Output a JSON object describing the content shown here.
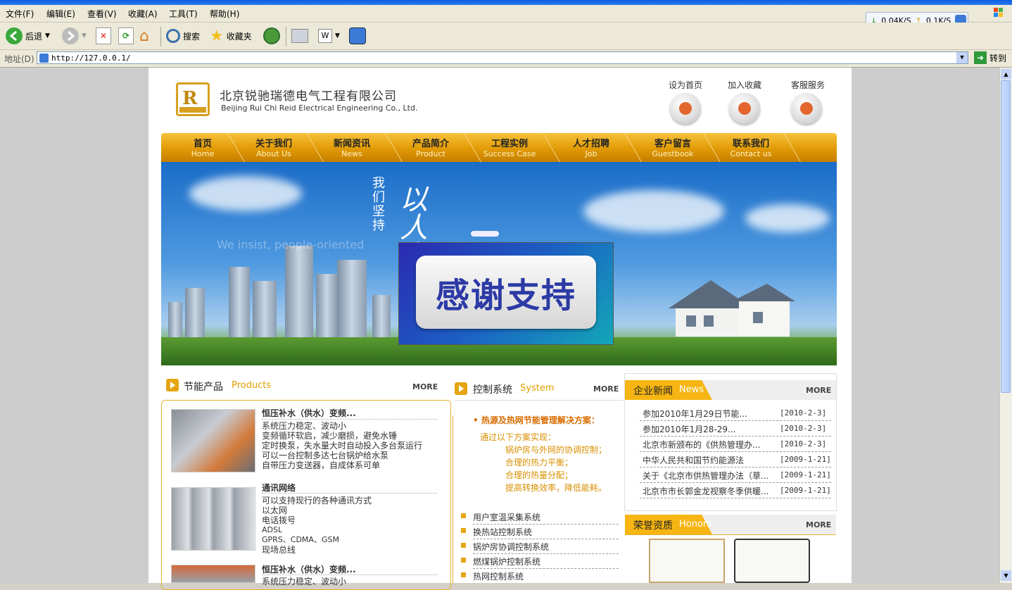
{
  "browser": {
    "menu": [
      "文件(F)",
      "编辑(E)",
      "查看(V)",
      "收藏(A)",
      "工具(T)",
      "帮助(H)"
    ],
    "toolbar": {
      "back": "后退",
      "search": "搜索",
      "favorites": "收藏夹"
    },
    "address_label": "地址(D)",
    "address_value": "http://127.0.0.1/",
    "go_label": "转到",
    "speed_down": "0.04K/S",
    "speed_up": "0.1K/S"
  },
  "header": {
    "company_cn": "北京锐驰瑞德电气工程有限公司",
    "company_en": "Beijing Rui Chi Reid Electrical Engineering Co., Ltd.",
    "links": [
      "设为首页",
      "加入收藏",
      "客服服务"
    ]
  },
  "nav": [
    {
      "cn": "首页",
      "en": "Home"
    },
    {
      "cn": "关于我们",
      "en": "About Us"
    },
    {
      "cn": "新闻资讯",
      "en": "News"
    },
    {
      "cn": "产品简介",
      "en": "Product"
    },
    {
      "cn": "工程实例",
      "en": "Success Case"
    },
    {
      "cn": "人才招聘",
      "en": "Job"
    },
    {
      "cn": "客户留言",
      "en": "Guestbook"
    },
    {
      "cn": "联系我们",
      "en": "Contact us"
    }
  ],
  "banner": {
    "slogan_small": "我们坚持",
    "slogan_big": "以人为本",
    "slogan_en": "We insist, people-oriented",
    "popup_text": "感谢支持"
  },
  "products": {
    "title_cn": "节能产品",
    "title_en": "Products",
    "more": "MORE",
    "items": [
      {
        "title": "恒压补水（供水）变频...",
        "lines": [
          "系统压力稳定、波动小",
          "变频循环软启，减少磨损，避免水锤",
          "定时换泵，失水量大时自动投入多台泵运行",
          "可以一台控制多达七台锅炉给水泵",
          "自带压力变送器，自成体系可单"
        ]
      },
      {
        "title": "通讯网络",
        "lines": [
          "可以支持现行的各种通讯方式",
          "以太网",
          "电话拨号",
          "ADSL",
          "GPRS、CDMA、GSM",
          "现场总线"
        ]
      },
      {
        "title": "恒压补水（供水）变频...",
        "lines": [
          "系统压力稳定、波动小"
        ]
      }
    ]
  },
  "system": {
    "title_cn": "控制系统",
    "title_en": "System",
    "more": "MORE",
    "heading": "• 热源及热网节能管理解决方案：",
    "intro": "通过以下方案实现：",
    "points": [
      "锅炉房与外网的协调控制；",
      "合理的热力平衡；",
      "合理的热量分配；",
      "提高转换效率，降低能耗。"
    ],
    "items": [
      "用户室温采集系统",
      "换热站控制系统",
      "锅炉房协调控制系统",
      "燃煤锅炉控制系统",
      "热网控制系统"
    ]
  },
  "news": {
    "title_cn": "企业新闻",
    "title_en": "News",
    "more": "MORE",
    "items": [
      {
        "title": "参加2010年1月29日节能...",
        "date": "[2010-2-3]"
      },
      {
        "title": "参加2010年1月28-29...",
        "date": "[2010-2-3]"
      },
      {
        "title": "北京市新颁布的《供热管理办...",
        "date": "[2010-2-3]"
      },
      {
        "title": "中华人民共和国节约能源法",
        "date": "[2009-1-21]"
      },
      {
        "title": "关于《北京市供热管理办法（草...",
        "date": "[2009-1-21]"
      },
      {
        "title": "北京市市长郭金龙视察冬季供暖...",
        "date": "[2009-1-21]"
      }
    ]
  },
  "honors": {
    "title_cn": "荣誉资质",
    "title_en": "Honors",
    "more": "MORE"
  },
  "colors": {
    "accent": "#f6b512",
    "nav_dark": "#c57e00",
    "link_orange": "#d86c00"
  }
}
